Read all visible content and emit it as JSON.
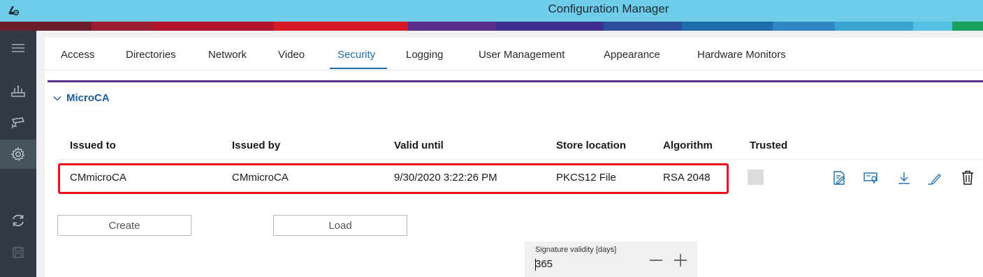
{
  "window": {
    "title": "Configuration Manager"
  },
  "colors": {
    "titlebar": "#6fcdea",
    "rail": "#323b45",
    "accent": "#1f6cab",
    "section_line": "#5b2d8e",
    "highlight_box": "#e8101a"
  },
  "strip_colors": [
    "#6d1e2c",
    "#9a1d32",
    "#b2122a",
    "#d81a24",
    "#5b2d8e",
    "#3d2f8e",
    "#2b4f9c",
    "#1f6cab",
    "#2f86c3",
    "#3aa4d3",
    "#52bfe3",
    "#19a05a"
  ],
  "rail": {
    "items": [
      {
        "icon": "hamburger-icon",
        "active": false
      },
      {
        "icon": "network-devices-icon",
        "active": false
      },
      {
        "icon": "camera-icon",
        "active": false
      },
      {
        "icon": "gear-icon",
        "active": true
      },
      {
        "icon": "refresh-icon",
        "active": false
      },
      {
        "icon": "save-icon",
        "active": false
      }
    ]
  },
  "tabs": [
    {
      "label": "Access"
    },
    {
      "label": "Directories"
    },
    {
      "label": "Network"
    },
    {
      "label": "Video"
    },
    {
      "label": "Security",
      "active": true
    },
    {
      "label": "Logging"
    },
    {
      "label": "User Management"
    },
    {
      "label": "Appearance"
    },
    {
      "label": "Hardware Monitors"
    }
  ],
  "section": {
    "title": "MicroCA",
    "expanded": true
  },
  "table": {
    "columns": [
      "Issued to",
      "Issued by",
      "Valid until",
      "Store location",
      "Algorithm",
      "Trusted"
    ],
    "rows": [
      {
        "issued_to": "CMmicroCA",
        "issued_by": "CMmicroCA",
        "valid_until": "9/30/2020 3:22:26 PM",
        "store_location": "PKCS12 File",
        "algorithm": "RSA 2048",
        "trusted": false,
        "actions": [
          "sign-certificate-icon",
          "certificate-details-icon",
          "download-icon",
          "edit-icon",
          "delete-icon"
        ]
      }
    ]
  },
  "buttons": {
    "create": "Create",
    "load": "Load"
  },
  "signature_validity": {
    "label": "Signature validity [days]",
    "value": "365"
  }
}
